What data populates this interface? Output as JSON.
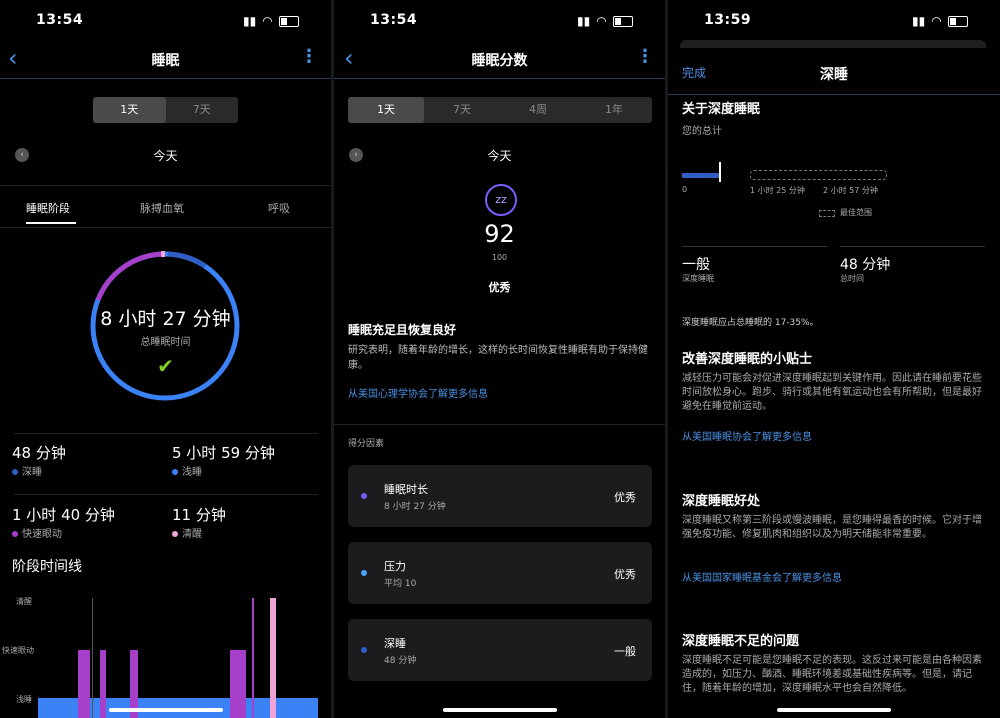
{
  "colors": {
    "accent": "#4a90e2",
    "deep": "#2f5ec4",
    "light": "#3b82f6",
    "rem": "#a63fc9",
    "awake": "#f0a4d8",
    "check": "#7ed321"
  },
  "panel1": {
    "status_time": "13:54",
    "title": "睡眠",
    "range_tabs": [
      "1天",
      "7天"
    ],
    "day_label": "今天",
    "tabs": [
      "睡眠阶段",
      "脉搏血氧",
      "呼吸"
    ],
    "ring": {
      "time": "8 小时 27 分钟",
      "caption": "总睡眠时间"
    },
    "stats": [
      {
        "value": "48 分钟",
        "label": "深睡"
      },
      {
        "value": "5 小时 59 分钟",
        "label": "浅睡"
      },
      {
        "value": "1 小时 40 分钟",
        "label": "快速眼动"
      },
      {
        "value": "11 分钟",
        "label": "清醒"
      }
    ],
    "timeline_title": "阶段时间线",
    "timeline_axis": [
      "清醒",
      "快速眼动",
      "浅睡"
    ]
  },
  "panel2": {
    "status_time": "13:54",
    "title": "睡眠分数",
    "range_tabs": [
      "1天",
      "7天",
      "4周",
      "1年"
    ],
    "day_label": "今天",
    "score": "92",
    "score_max": "100",
    "score_label": "优秀",
    "headline": "睡眠充足且恢复良好",
    "body": "研究表明，随着年龄的增长，这样的长时间恢复性睡眠有助于保持健康。",
    "link": "从美国心理学协会了解更多信息",
    "factors_title": "得分因素",
    "factors": [
      {
        "name": "睡眠时长",
        "sub": "8 小时 27 分钟",
        "rating": "优秀",
        "color": "#7c5cff"
      },
      {
        "name": "压力",
        "sub": "平均 10",
        "rating": "优秀",
        "color": "#4aa3ff"
      },
      {
        "name": "深睡",
        "sub": "48 分钟",
        "rating": "一般",
        "color": "#2f5ec4"
      }
    ]
  },
  "panel3": {
    "status_time": "13:59",
    "done": "完成",
    "title": "深睡",
    "about_title": "关于深度睡眠",
    "your_total": "您的总计",
    "bar_labels": [
      "0",
      "1 小时 25 分钟",
      "2 小时 57 分钟"
    ],
    "best_range": "最佳范围",
    "rating": "一般",
    "rating_label": "深度睡眠",
    "duration": "48 分钟",
    "duration_label": "总时间",
    "share_note": "深度睡眠应占总睡眠的 17-35%。",
    "tips_title": "改善深度睡眠的小贴士",
    "tips_body": "减轻压力可能会对促进深度睡眠起到关键作用。因此请在睡前要花些时间放松身心。跑步、骑行或其他有氧运动也会有所帮助，但是最好避免在睡觉前运动。",
    "tips_link": "从美国睡眠协会了解更多信息",
    "benefits_title": "深度睡眠好处",
    "benefits_body": "深度睡眠又称第三阶段或慢波睡眠，是您睡得最香的时候。它对于增强免疫功能、修复肌肉和组织以及为明天储能非常重要。",
    "benefits_link": "从美国国家睡眠基金会了解更多信息",
    "lack_title": "深度睡眠不足的问题",
    "lack_body": "深度睡眠不足可能是您睡眠不足的表现。这反过来可能是由各种因素造成的，如压力、酗酒、睡眠环境差或基础性疾病等。但是，请记住，随着年龄的增加，深度睡眠水平也会自然降低。"
  }
}
